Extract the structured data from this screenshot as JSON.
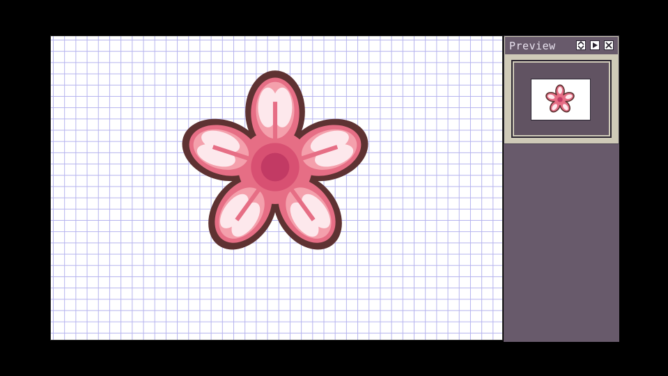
{
  "preview_panel": {
    "title": "Preview",
    "buttons": [
      "zoom-fit",
      "play",
      "close"
    ]
  },
  "colors": {
    "outline": "#5e3232",
    "petal_dark": "#e66e85",
    "petal_mid": "#f4a0ac",
    "petal_light": "#fde8ec",
    "center": "#c23a64",
    "center_ring": "#d85072",
    "grid_line": "#b4b2ee",
    "dock_bg": "#685a6b"
  }
}
